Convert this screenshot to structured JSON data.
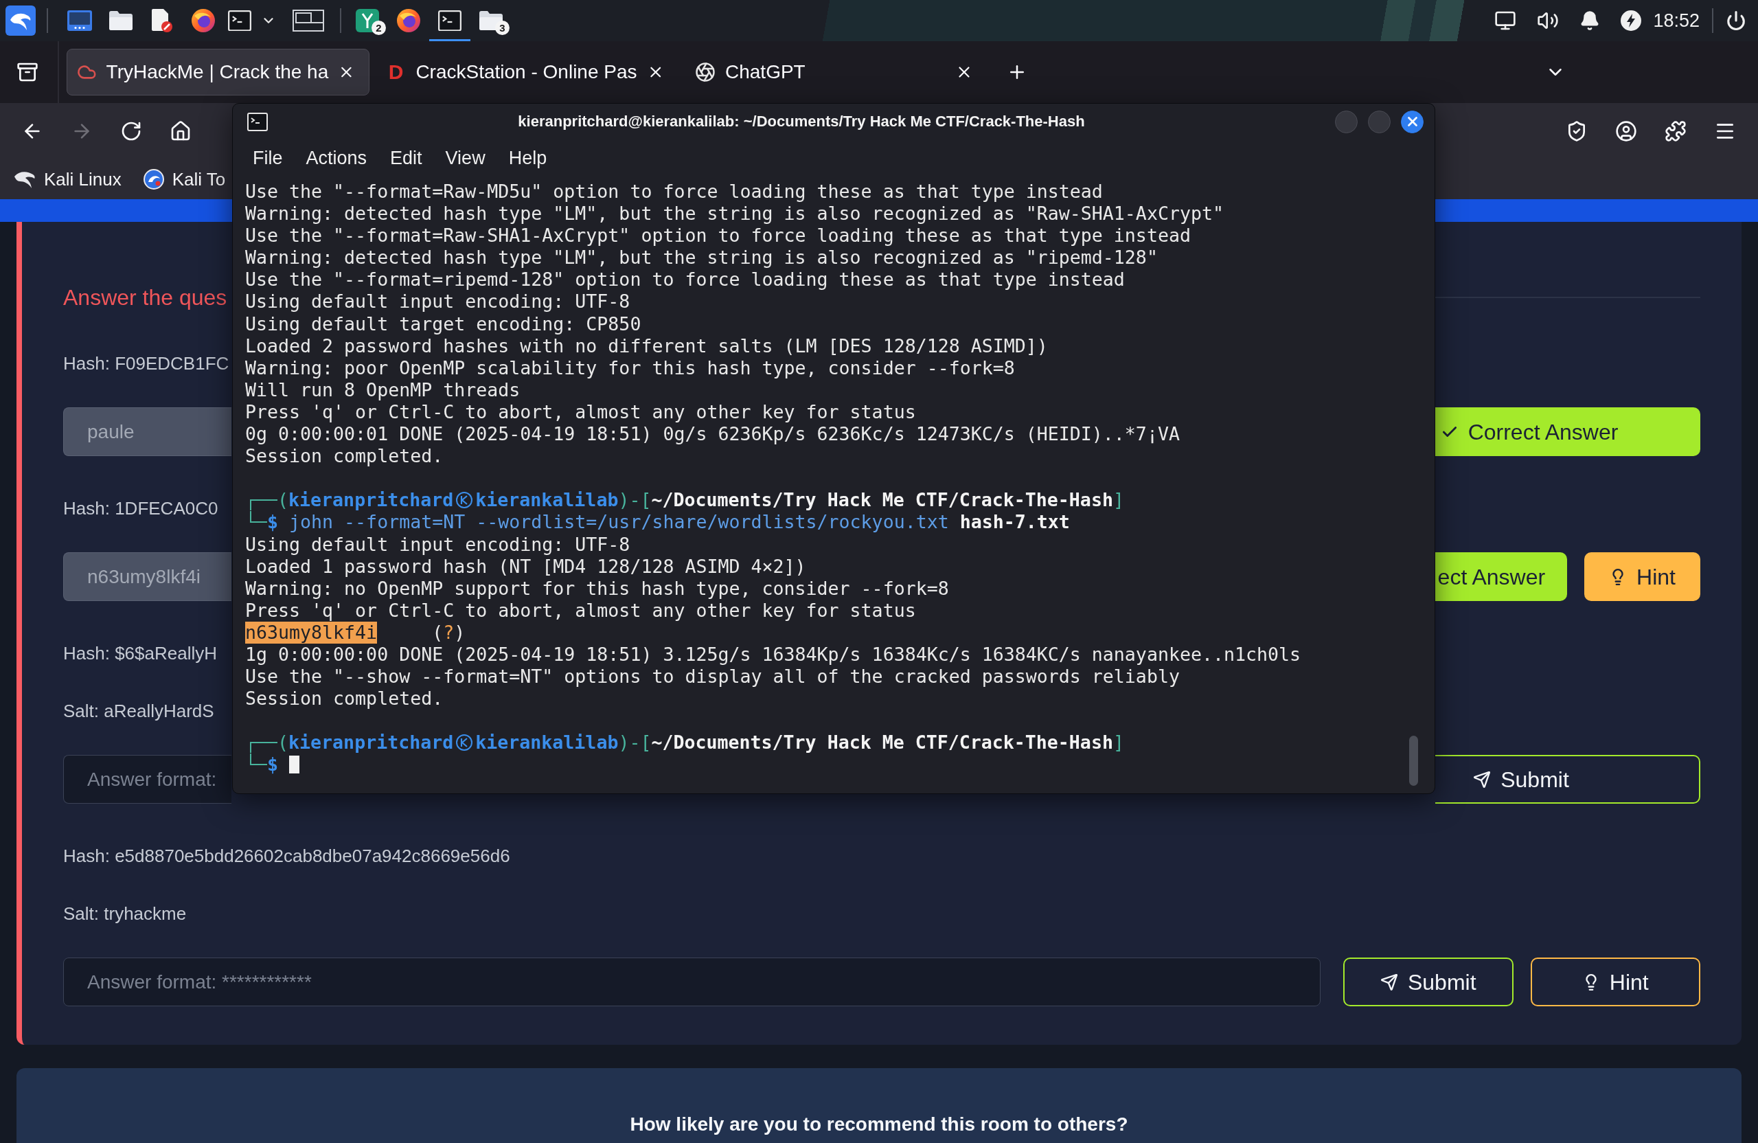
{
  "taskbar": {
    "windows": [
      {
        "kind": "app",
        "badge": "2",
        "selected": false
      },
      {
        "kind": "browser",
        "selected": false
      },
      {
        "kind": "terminal",
        "selected": true
      },
      {
        "kind": "folder",
        "badge": "3",
        "selected": false
      }
    ],
    "clock": "18:52"
  },
  "browser": {
    "tabs": [
      {
        "kind": "cloud",
        "title": "TryHackMe | Crack the ha",
        "selected": true
      },
      {
        "kind": "letter",
        "letter": "D",
        "title": "CrackStation - Online Pas",
        "selected": false
      },
      {
        "kind": "aperture",
        "title": "ChatGPT",
        "selected": false
      }
    ],
    "nav_buttons": [
      {
        "kind": "back",
        "disabled": false
      },
      {
        "kind": "forward",
        "disabled": true
      },
      {
        "kind": "reload",
        "disabled": false
      },
      {
        "kind": "home",
        "disabled": false
      }
    ],
    "bookmarks": [
      {
        "kind": "swoosh",
        "label": "Kali Linux"
      },
      {
        "kind": "emblem",
        "label": "Kali To"
      }
    ]
  },
  "terminal": {
    "title": "kieranpritchard@kierankalilab: ~/Documents/Try Hack Me CTF/Crack-The-Hash",
    "menu": [
      "File",
      "Actions",
      "Edit",
      "View",
      "Help"
    ],
    "lines": [
      {
        "kind": "text",
        "text": "Use the \"--format=Raw-MD5u\" option to force loading these as that type instead"
      },
      {
        "kind": "text",
        "text": "Warning: detected hash type \"LM\", but the string is also recognized as \"Raw-SHA1-AxCrypt\""
      },
      {
        "kind": "text",
        "text": "Use the \"--format=Raw-SHA1-AxCrypt\" option to force loading these as that type instead"
      },
      {
        "kind": "text",
        "text": "Warning: detected hash type \"LM\", but the string is also recognized as \"ripemd-128\""
      },
      {
        "kind": "text",
        "text": "Use the \"--format=ripemd-128\" option to force loading these as that type instead"
      },
      {
        "kind": "text",
        "text": "Using default input encoding: UTF-8"
      },
      {
        "kind": "text",
        "text": "Using default target encoding: CP850"
      },
      {
        "kind": "text",
        "text": "Loaded 2 password hashes with no different salts (LM [DES 128/128 ASIMD])"
      },
      {
        "kind": "text",
        "text": "Warning: poor OpenMP scalability for this hash type, consider --fork=8"
      },
      {
        "kind": "text",
        "text": "Will run 8 OpenMP threads"
      },
      {
        "kind": "text",
        "text": "Press 'q' or Ctrl-C to abort, almost any other key for status"
      },
      {
        "kind": "text",
        "text": "0g 0:00:00:01 DONE (2025-04-19 18:51) 0g/s 6236Kp/s 6236Kc/s 12473KC/s (HEIDI)..*7¡VA"
      },
      {
        "kind": "text",
        "text": "Session completed."
      },
      {
        "kind": "blank"
      },
      {
        "kind": "prompt",
        "open": "(",
        "user": "kieranpritchard",
        "host": "kierankalilab",
        "separator": ")-[",
        "path": "~/Documents/Try Hack Me CTF/Crack-The-Hash",
        "close": "]"
      },
      {
        "kind": "command",
        "sign": "$",
        "command": "john --format=NT --wordlist=/usr/share/wordlists/rockyou.txt",
        "argument": "hash-7.txt"
      },
      {
        "kind": "text",
        "text": "Using default input encoding: UTF-8"
      },
      {
        "kind": "text",
        "text": "Loaded 1 password hash (NT [MD4 128/128 ASIMD 4×2])"
      },
      {
        "kind": "text",
        "text": "Warning: no OpenMP support for this hash type, consider --fork=8"
      },
      {
        "kind": "text",
        "text": "Press 'q' or Ctrl-C to abort, almost any other key for status"
      },
      {
        "kind": "cracked",
        "password": "n63umy8lkf4i",
        "open": "(",
        "user": "?",
        "close": ")"
      },
      {
        "kind": "text",
        "text": "1g 0:00:00:00 DONE (2025-04-19 18:51) 3.125g/s 16384Kp/s 16384Kc/s 16384KC/s nanayankee..n1ch0ls"
      },
      {
        "kind": "text",
        "text": "Use the \"--show --format=NT\" options to display all of the cracked passwords reliably"
      },
      {
        "kind": "text",
        "text": "Session completed."
      },
      {
        "kind": "blank"
      },
      {
        "kind": "prompt",
        "open": "(",
        "user": "kieranpritchard",
        "host": "kierankalilab",
        "separator": ")-[",
        "path": "~/Documents/Try Hack Me CTF/Crack-The-Hash",
        "close": "]"
      },
      {
        "kind": "input",
        "sign": "$"
      }
    ]
  },
  "page": {
    "heading": "Answer the ques",
    "questions": [
      {
        "lines": [
          "Hash: F09EDCB1FC"
        ],
        "answer": {
          "value": "paule",
          "disabled": true
        },
        "buttons": [
          {
            "kind": "correct",
            "label": "Correct Answer",
            "filled": true,
            "checkmark": true
          }
        ]
      },
      {
        "lines": [
          "Hash: 1DFECA0C0"
        ],
        "answer": {
          "value": "n63umy8lkf4i",
          "disabled": true
        },
        "buttons": [
          {
            "kind": "correct",
            "label": "ect Answer",
            "filled": true,
            "checkmark": false
          },
          {
            "kind": "hint",
            "label": "Hint",
            "filled": true
          }
        ]
      },
      {
        "lines": [
          "Hash: $6$aReallyH",
          "Salt: aReallyHardS"
        ],
        "answer": {
          "placeholder": "Answer format:",
          "disabled": false
        },
        "buttons": [
          {
            "kind": "submit",
            "label": "Submit",
            "filled": false
          }
        ]
      },
      {
        "lines": [
          "Hash: e5d8870e5bdd26602cab8dbe07a942c8669e56d6",
          "Salt: tryhackme"
        ],
        "answer": {
          "placeholder": "Answer format: ************",
          "disabled": false
        },
        "buttons": [
          {
            "kind": "submit",
            "label": "Submit",
            "filled": false
          },
          {
            "kind": "hint",
            "label": "Hint",
            "filled": false
          }
        ]
      }
    ],
    "feedback": "How likely are you to recommend this room to others?"
  }
}
